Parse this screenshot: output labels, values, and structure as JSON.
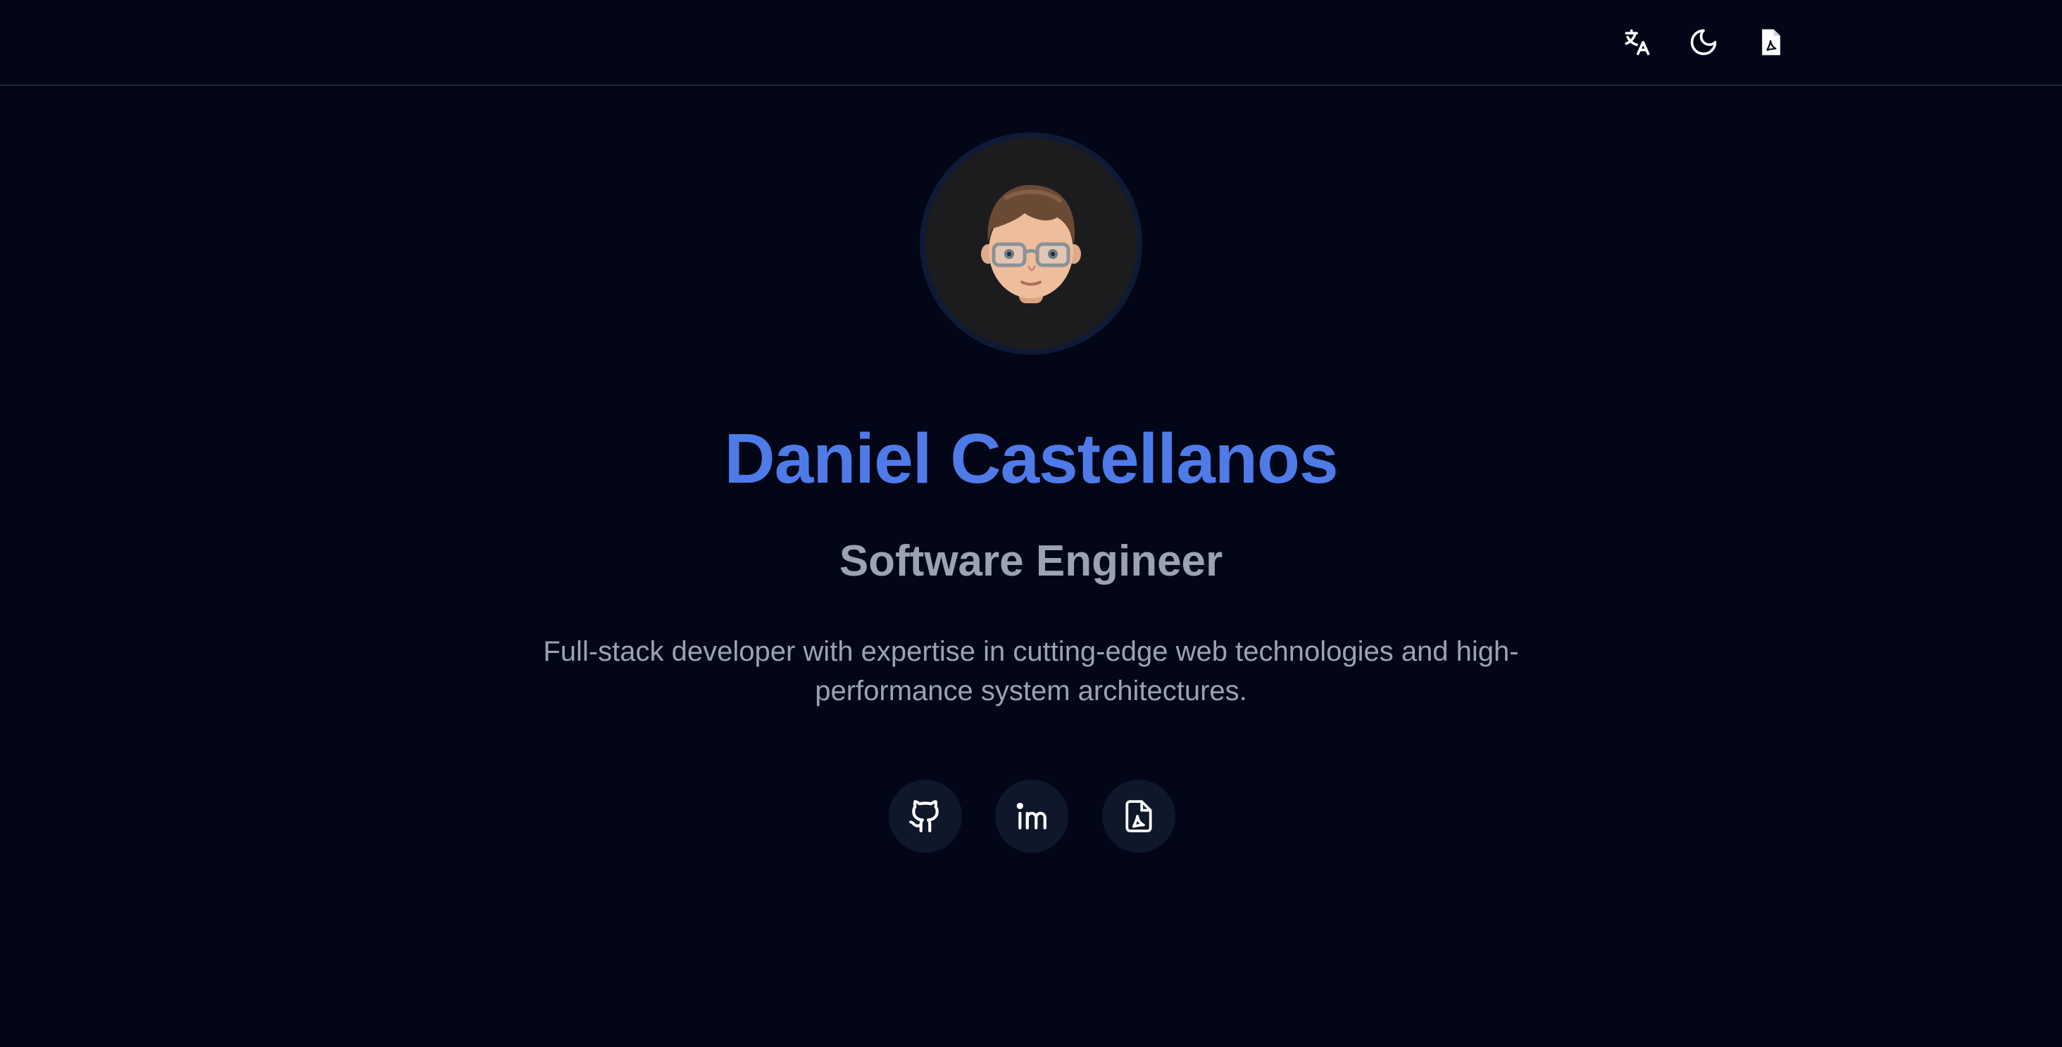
{
  "header": {
    "icons": [
      "translate-icon",
      "moon-icon",
      "pdf-icon"
    ]
  },
  "profile": {
    "name": "Daniel Castellanos",
    "title": "Software Engineer",
    "description": "Full-stack developer with expertise in cutting-edge web technologies and high-performance system architectures."
  },
  "social": {
    "icons": [
      "github-icon",
      "linkedin-icon",
      "pdf-file-icon"
    ]
  },
  "colors": {
    "background": "#020617",
    "accent": "#4f7be8",
    "muted_text": "#9ca3af",
    "icon_bg": "#0f172a"
  }
}
